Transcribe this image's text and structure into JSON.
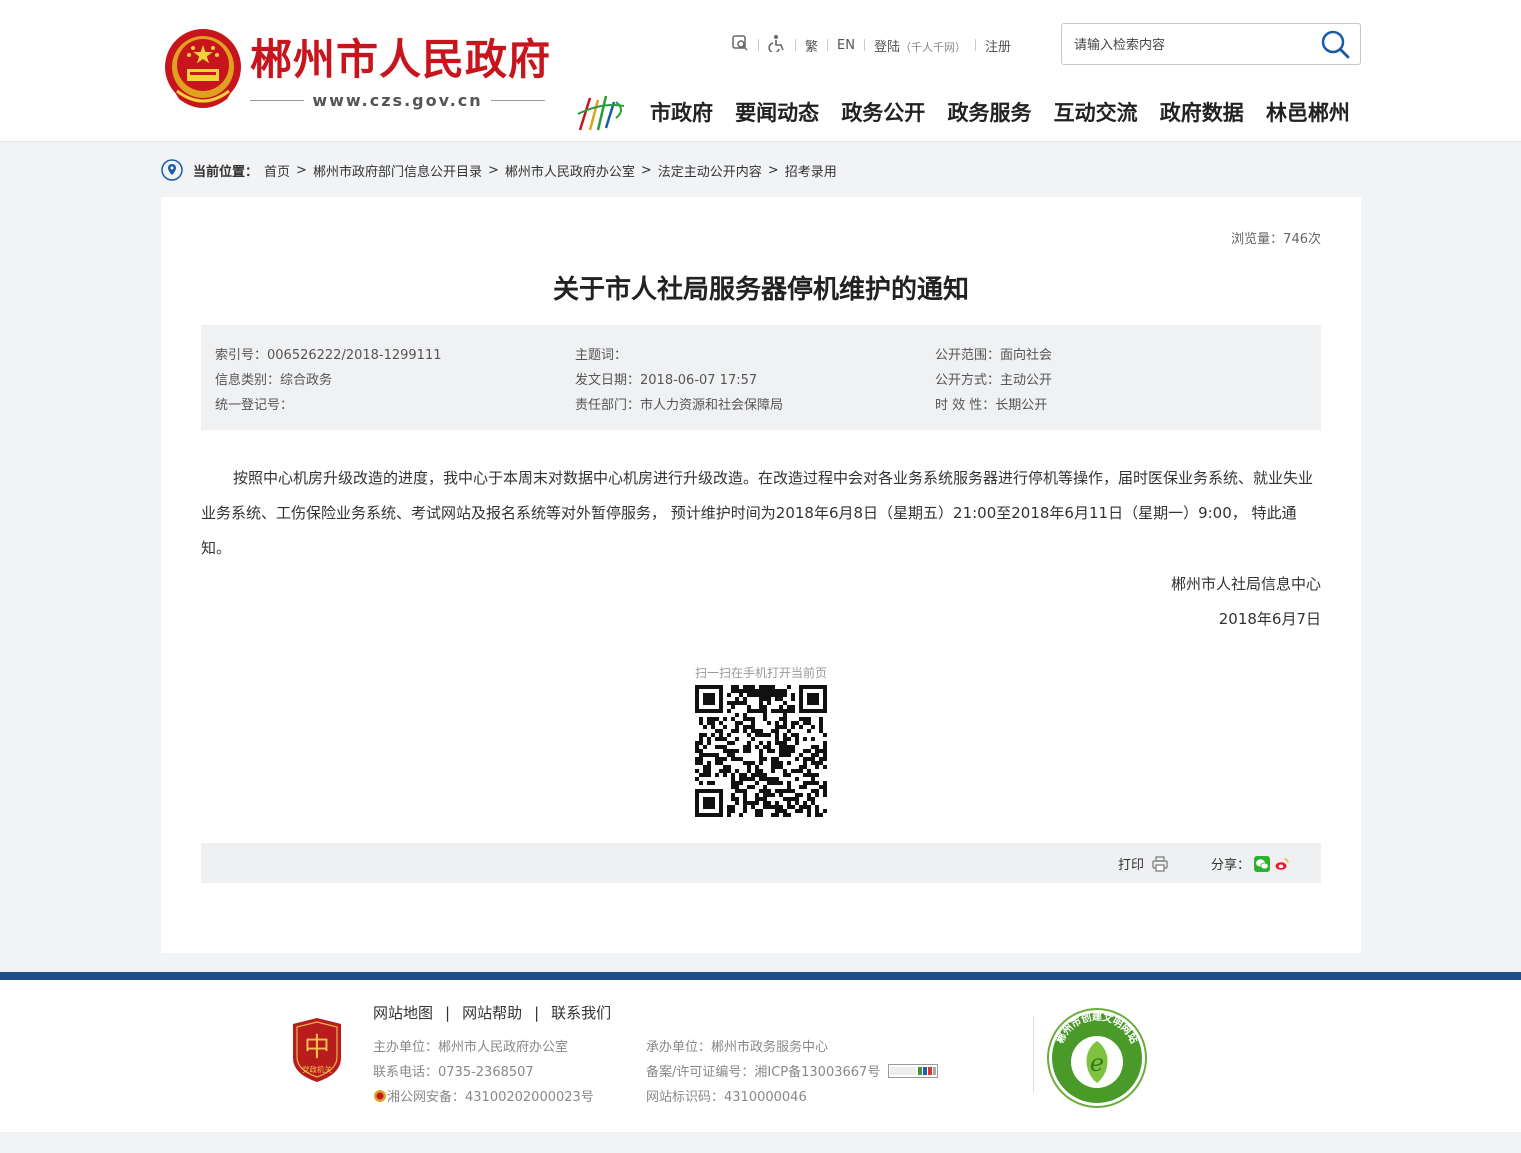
{
  "header": {
    "site_title": "郴州市人民政府",
    "site_url": "www.czs.gov.cn",
    "tools": {
      "traditional": "繁",
      "english": "EN",
      "login": "登陆",
      "login_note": "（千人千网）",
      "register": "注册"
    },
    "search": {
      "placeholder": "请输入检索内容"
    },
    "nav": [
      "市政府",
      "要闻动态",
      "政务公开",
      "政务服务",
      "互动交流",
      "政府数据",
      "林邑郴州"
    ]
  },
  "breadcrumb": {
    "label": "当前位置：",
    "items": [
      "首页",
      "郴州市政府部门信息公开目录",
      "郴州市人民政府办公室",
      "法定主动公开内容",
      "招考录用"
    ],
    "separator": ">"
  },
  "article": {
    "views": "浏览量：746次",
    "title": "关于市人社局服务器停机维护的通知",
    "meta": {
      "index_no": "索引号：006526222/2018-1299111",
      "topic": "主题词：",
      "scope": "公开范围：面向社会",
      "category": "信息类别：综合政务",
      "date": "发文日期：2018-06-07 17:57",
      "method": "公开方式：主动公开",
      "reg_no": "统一登记号：",
      "dept": "责任部门：市人力资源和社会保障局",
      "validity": "时 效 性：长期公开"
    },
    "body": "按照中心机房升级改造的进度，我中心于本周末对数据中心机房进行升级改造。在改造过程中会对各业务系统服务器进行停机等操作，届时医保业务系统、就业失业业务系统、工伤保险业务系统、考试网站及报名系统等对外暂停服务， 预计维护时间为2018年6月8日（星期五）21:00至2018年6月11日（星期一）9:00， 特此通知。",
    "signature": "郴州市人社局信息中心",
    "sign_date": "2018年6月7日",
    "qr_tip": "扫一扫在手机打开当前页",
    "print_label": "打印",
    "share_label": "分享："
  },
  "footer": {
    "links": [
      "网站地图",
      "网站帮助",
      "联系我们"
    ],
    "link_sep": "|",
    "sponsor": "主办单位：郴州市人民政府办公室",
    "phone": "联系电话：0735-2368507",
    "police": "湘公网安备：43100202000023号",
    "operator": "承办单位：郴州市政务服务中心",
    "icp": "备案/许可证编号：湘ICP备13003667号",
    "site_code": "网站标识码：4310000046",
    "party_badge": "党政机关",
    "civil_badge": "郴州市创建文明网站"
  },
  "colors": {
    "brand_red": "#c8151d",
    "footer_blue": "#1f4e8c",
    "accent_blue": "#1a5aa8"
  }
}
